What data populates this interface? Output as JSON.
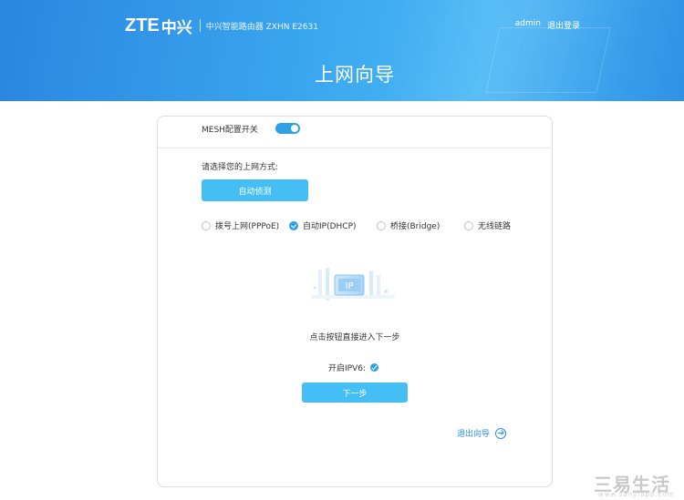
{
  "header": {
    "logo_brand": "ZTE",
    "logo_cn": "中兴",
    "model": "中兴智能路由器 ZXHN E2631",
    "username": "admin",
    "logout": "退出登录",
    "page_title": "上网向导"
  },
  "mesh": {
    "label": "MESH配置开关",
    "enabled": true
  },
  "wizard": {
    "prompt": "请选择您的上网方式:",
    "detect_button": "自动侦测",
    "options": [
      {
        "label": "拨号上网(PPPoE)",
        "selected": false
      },
      {
        "label": "自动IP(DHCP)",
        "selected": true
      },
      {
        "label": "桥接(Bridge)",
        "selected": false
      },
      {
        "label": "无线链路",
        "selected": false
      }
    ],
    "illustration_text": "IP",
    "hint": "点击按钮直接进入下一步",
    "ipv6_label": "开启IPV6:",
    "ipv6_enabled": true,
    "next_button": "下一步",
    "exit_link": "退出向导"
  },
  "colors": {
    "accent": "#2da0e6",
    "button": "#45bdf5",
    "link": "#2a8fe0"
  },
  "watermark": {
    "text": "三易生活",
    "sub": "www.sanyiapp.com"
  }
}
